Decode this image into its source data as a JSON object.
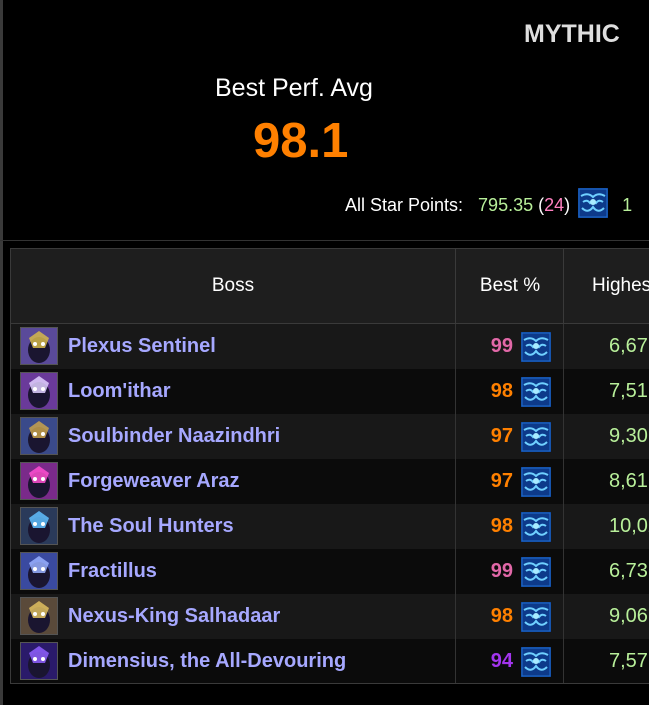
{
  "header": {
    "difficulty": "MYTHIC",
    "perf_label": "Best Perf. Avg",
    "perf_value": "98.1",
    "star_points_label": "All Star Points:",
    "star_points_value": "795.35",
    "star_points_paren_open": "(",
    "star_points_rank": "24",
    "star_points_paren_close": ")",
    "star_points_clipped": "1"
  },
  "colors": {
    "legendary": "#ff8000",
    "pink": "#e268a8",
    "epic": "#a335ee",
    "points": "#b8ef9a",
    "boss_name": "#a6a8ff"
  },
  "table": {
    "columns": [
      "Boss",
      "Best %",
      "Highes"
    ],
    "rows": [
      {
        "boss": "Plexus Sentinel",
        "best": "99",
        "best_color": "#e268a8",
        "highest": "6,67",
        "icon": "plexus-sentinel-icon",
        "spec_icon": "frost-spec-icon"
      },
      {
        "boss": "Loom'ithar",
        "best": "98",
        "best_color": "#ff8000",
        "highest": "7,51",
        "icon": "loomithar-icon",
        "spec_icon": "frost-spec-icon"
      },
      {
        "boss": "Soulbinder Naazindhri",
        "best": "97",
        "best_color": "#ff8000",
        "highest": "9,30",
        "icon": "soulbinder-naazindhri-icon",
        "spec_icon": "frost-spec-icon"
      },
      {
        "boss": "Forgeweaver Araz",
        "best": "97",
        "best_color": "#ff8000",
        "highest": "8,61",
        "icon": "forgeweaver-araz-icon",
        "spec_icon": "frost-spec-icon"
      },
      {
        "boss": "The Soul Hunters",
        "best": "98",
        "best_color": "#ff8000",
        "highest": "10,02",
        "icon": "soul-hunters-icon",
        "spec_icon": "frost-spec-icon"
      },
      {
        "boss": "Fractillus",
        "best": "99",
        "best_color": "#e268a8",
        "highest": "6,73",
        "icon": "fractillus-icon",
        "spec_icon": "frost-spec-icon"
      },
      {
        "boss": "Nexus-King Salhadaar",
        "best": "98",
        "best_color": "#ff8000",
        "highest": "9,06",
        "icon": "nexus-king-salhadaar-icon",
        "spec_icon": "frost-spec-icon"
      },
      {
        "boss": "Dimensius, the All-Devouring",
        "best": "94",
        "best_color": "#a335ee",
        "highest": "7,57",
        "icon": "dimensius-icon",
        "spec_icon": "frost-spec-icon"
      }
    ]
  }
}
